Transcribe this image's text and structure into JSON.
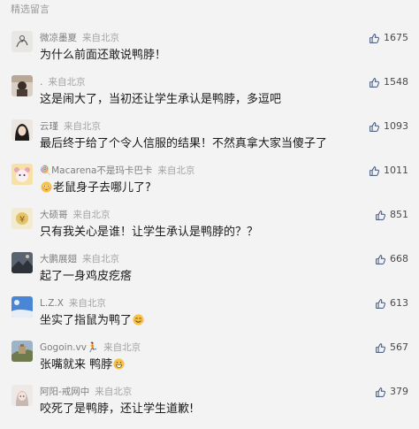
{
  "section_title": "精选留言",
  "colors": {
    "background": "#f3f3f3",
    "name": "#7d7d7d",
    "location": "#a3a3a3",
    "content": "#1a1a1a",
    "like_icon": "#3c4f7a"
  },
  "comments": [
    {
      "name": "微凉墨夏",
      "location": "来自北京",
      "content": "为什么前面还敢说鸭脖！",
      "likes": "1675",
      "avatar_icon": "sketch-figure-avatar"
    },
    {
      "name": ".",
      "location": "来自北京",
      "content": "这是闹大了，当初还让学生承认是鸭脖，多逗吧",
      "likes": "1548",
      "avatar_icon": "hooded-person-avatar"
    },
    {
      "name": "云瑾",
      "location": "来自北京",
      "content": "最后终于给了个令人信服的结果！不然真拿大家当傻子了",
      "likes": "1093",
      "avatar_icon": "girl-portrait-avatar"
    },
    {
      "name_prefix": "🍭",
      "name": "Macarena不是玛卡巴卡",
      "location": "来自北京",
      "content_emoji": "flushed-face-emoji",
      "content": "老鼠身子去哪儿了?",
      "likes": "1011",
      "avatar_icon": "cartoon-bear-avatar"
    },
    {
      "name": "大硕哥",
      "location": "来自北京",
      "content": "只有我关心是谁！让学生承认是鸭脖的？？",
      "likes": "851",
      "avatar_icon": "money-symbol-avatar"
    },
    {
      "name": "大鹏展翅",
      "location": "来自北京",
      "content": "起了一身鸡皮疙瘩",
      "likes": "668",
      "avatar_icon": "dark-landscape-avatar"
    },
    {
      "name": "L.Z.X",
      "location": "来自北京",
      "content": "坐实了指鼠为鸭了",
      "content_emoji_after": "smiling-face-emoji",
      "likes": "613",
      "avatar_icon": "blue-sky-avatar"
    },
    {
      "name": "Gogoin.vv",
      "name_suffix": "🏃",
      "location": "来自北京",
      "content": "张嘴就来 鸭脖",
      "content_emoji_after": "grinning-face-emoji",
      "likes": "567",
      "avatar_icon": "great-wall-avatar"
    },
    {
      "name": "阿阳-戒网中",
      "location": "来自北京",
      "content": "咬死了是鸭脖，还让学生道歉!",
      "likes": "379",
      "avatar_icon": "anime-character-avatar"
    }
  ]
}
